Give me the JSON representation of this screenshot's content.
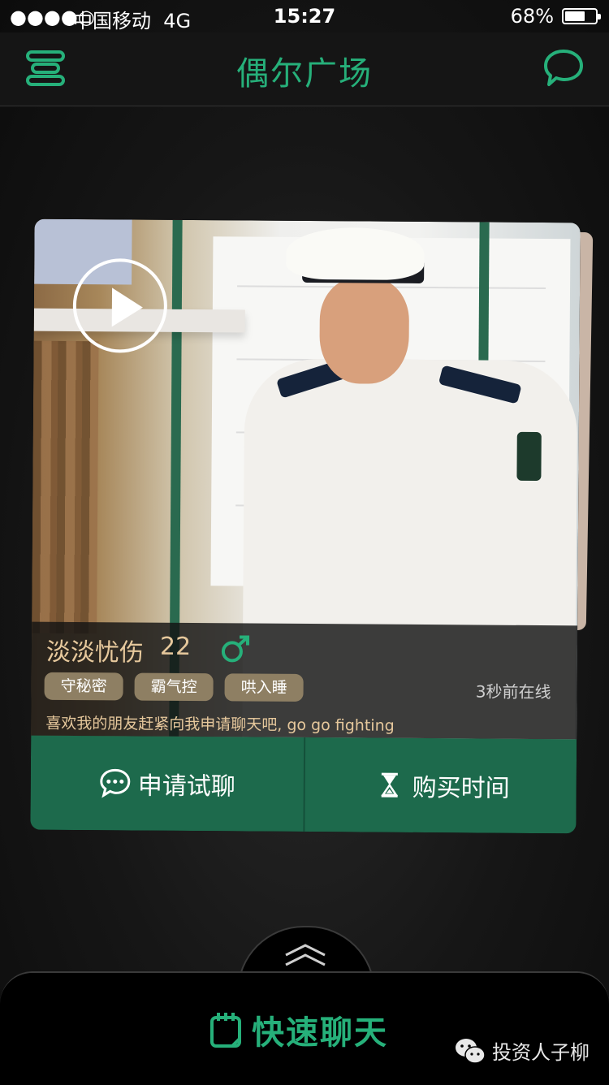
{
  "status_bar": {
    "signal": "●●●●○",
    "carrier": "中国移动",
    "network": "4G",
    "time": "15:27",
    "battery_percent_text": "68%",
    "battery_level": 0.68
  },
  "nav": {
    "title": "偶尔广场",
    "menu_icon": "menu-icon",
    "chat_icon": "chat-bubble-icon"
  },
  "profile": {
    "name": "淡淡忧伤",
    "age": "22",
    "gender_icon": "male-icon",
    "tags": [
      "守秘密",
      "霸气控",
      "哄入睡"
    ],
    "online_status": "3秒前在线",
    "motto": "喜欢我的朋友赶紧向我申请聊天吧, go go fighting"
  },
  "actions": {
    "apply_label": "申请试聊",
    "buy_label": "购买时间"
  },
  "bottom": {
    "quick_chat_label": "快速聊天",
    "watermark": "投资人子柳"
  },
  "colors": {
    "accent": "#26b07a",
    "action_bg": "#1d6a4c",
    "name_gold": "#e6c89c",
    "tag_bg": "#8e7f63"
  }
}
